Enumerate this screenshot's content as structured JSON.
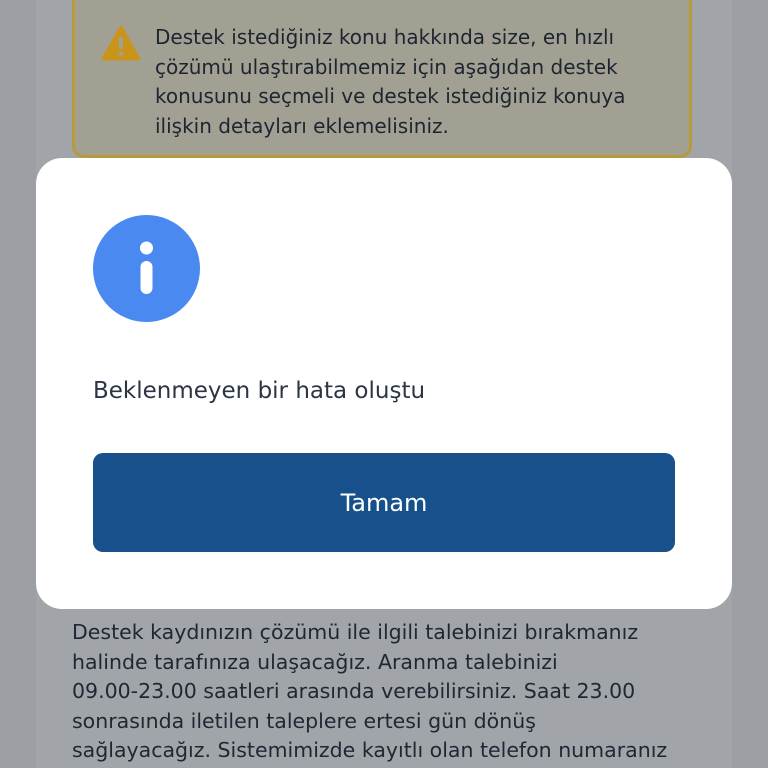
{
  "background": {
    "warning": {
      "icon": "warning-triangle-icon",
      "lines": [
        "Destek istediğiniz konu hakkında size, en hızlı",
        "çözümü ulaştırabilmemiz için aşağıdan destek",
        "konusunu seçmeli ve destek istediğiniz konuya",
        "ilişkin detayları eklemelisiniz."
      ]
    },
    "info_lines": [
      "Destek kaydınızın çözümü ile ilgili talebinizi bırakmanız",
      "halinde tarafınıza ulaşacağız. Aranma talebinizi",
      "09.00-23.00 saatleri arasında verebilirsiniz. Saat 23.00",
      "sonrasında iletilen taleplere ertesi gün dönüş",
      "sağlayacağız. Sistemimizde kayıtlı olan telefon numaranız"
    ]
  },
  "modal": {
    "icon": "info-icon",
    "message": "Beklenmeyen bir hata oluştu",
    "button_label": "Tamam"
  },
  "colors": {
    "overlay": "#9c9fa4",
    "modal_background": "#ffffff",
    "info_icon": "#4a8af0",
    "button": "#17508a",
    "warning_border": "#b89a3c",
    "warning_icon": "#c9941a"
  }
}
